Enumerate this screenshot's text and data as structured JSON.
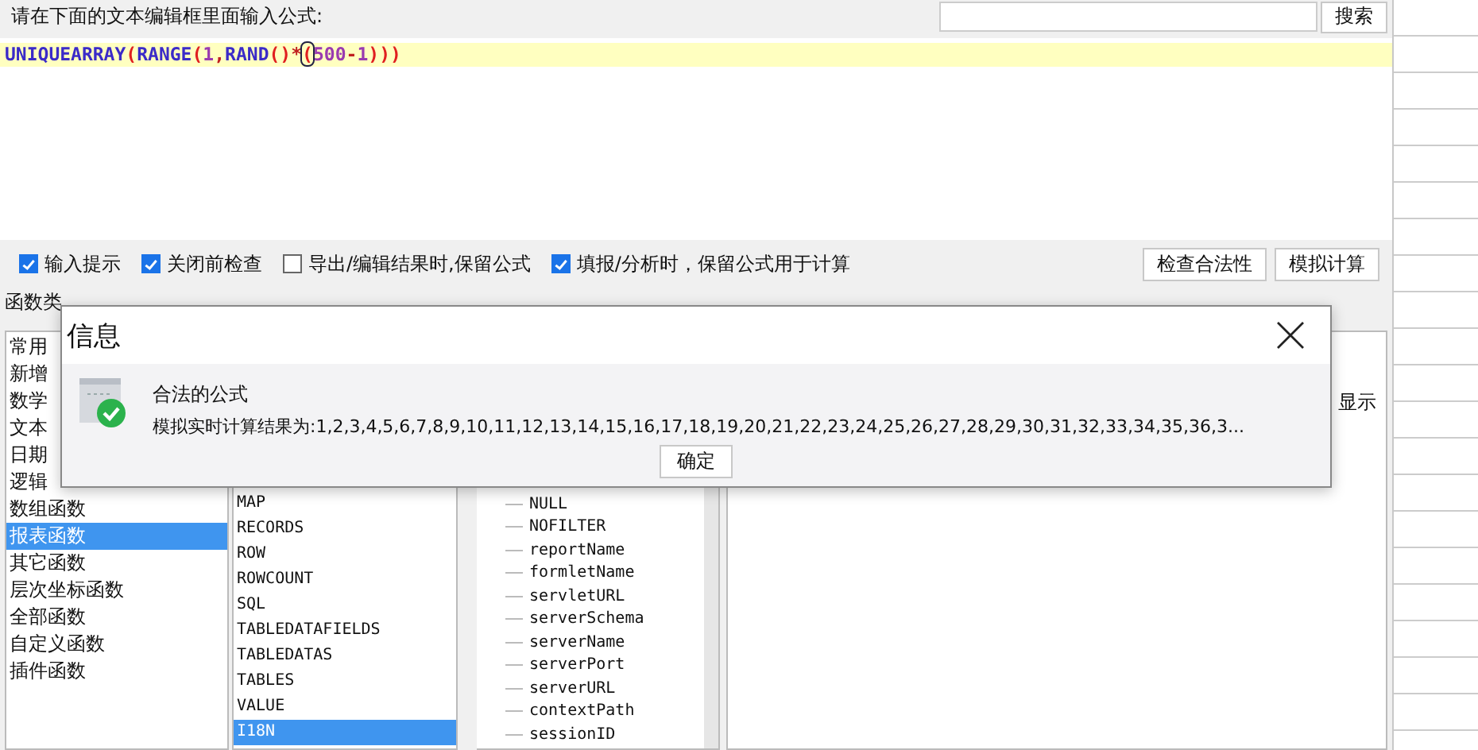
{
  "prompt": "请在下面的文本编辑框里面输入公式:",
  "search": {
    "button": "搜索"
  },
  "formula": [
    {
      "text": "UNIQUEARRAY",
      "kind": "function"
    },
    {
      "text": "(",
      "kind": "paren"
    },
    {
      "text": "RANGE",
      "kind": "function"
    },
    {
      "text": "(",
      "kind": "paren"
    },
    {
      "text": "1",
      "kind": "number"
    },
    {
      "text": ",",
      "kind": "operator"
    },
    {
      "text": "RAND",
      "kind": "function"
    },
    {
      "text": "()",
      "kind": "paren"
    },
    {
      "text": "*",
      "kind": "operator"
    },
    {
      "text": "(",
      "kind": "cursor"
    },
    {
      "text": "500",
      "kind": "number"
    },
    {
      "text": "-",
      "kind": "operator"
    },
    {
      "text": "1",
      "kind": "number"
    },
    {
      "text": ")))",
      "kind": "paren"
    }
  ],
  "options": [
    {
      "label": "输入提示",
      "checked": true
    },
    {
      "label": "关闭前检查",
      "checked": true
    },
    {
      "label": "导出/编辑结果时,保留公式",
      "checked": false
    },
    {
      "label": "填报/分析时，保留公式用于计算",
      "checked": true
    }
  ],
  "actions": [
    "检查合法性",
    "模拟计算"
  ],
  "category_header": "函数类",
  "categories": [
    {
      "label": "常用",
      "selected": false
    },
    {
      "label": "新增",
      "selected": false
    },
    {
      "label": "数学",
      "selected": false
    },
    {
      "label": "文本",
      "selected": false
    },
    {
      "label": "日期",
      "selected": false
    },
    {
      "label": "逻辑",
      "selected": false
    },
    {
      "label": "数组函数",
      "selected": false
    },
    {
      "label": "报表函数",
      "selected": true
    },
    {
      "label": "其它函数",
      "selected": false
    },
    {
      "label": "层次坐标函数",
      "selected": false
    },
    {
      "label": "全部函数",
      "selected": false
    },
    {
      "label": "自定义函数",
      "selected": false
    },
    {
      "label": "插件函数",
      "selected": false
    }
  ],
  "functions": [
    {
      "label": "MAP",
      "selected": false
    },
    {
      "label": "RECORDS",
      "selected": false
    },
    {
      "label": "ROW",
      "selected": false
    },
    {
      "label": "ROWCOUNT",
      "selected": false
    },
    {
      "label": "SQL",
      "selected": false
    },
    {
      "label": "TABLEDATAFIELDS",
      "selected": false
    },
    {
      "label": "TABLEDATAS",
      "selected": false
    },
    {
      "label": "TABLES",
      "selected": false
    },
    {
      "label": "VALUE",
      "selected": false
    },
    {
      "label": "I18N",
      "selected": true
    }
  ],
  "variables": [
    "NULL",
    "NOFILTER",
    "reportName",
    "formletName",
    "servletURL",
    "serverSchema",
    "serverName",
    "serverPort",
    "serverURL",
    "contextPath",
    "sessionID"
  ],
  "description": "显示",
  "dialog": {
    "title": "信息",
    "heading": "合法的公式",
    "result": "模拟实时计算结果为:1,2,3,4,5,6,7,8,9,10,11,12,13,14,15,16,17,18,19,20,21,22,23,24,25,26,27,28,29,30,31,32,33,34,35,36,3...",
    "button": "确定"
  }
}
